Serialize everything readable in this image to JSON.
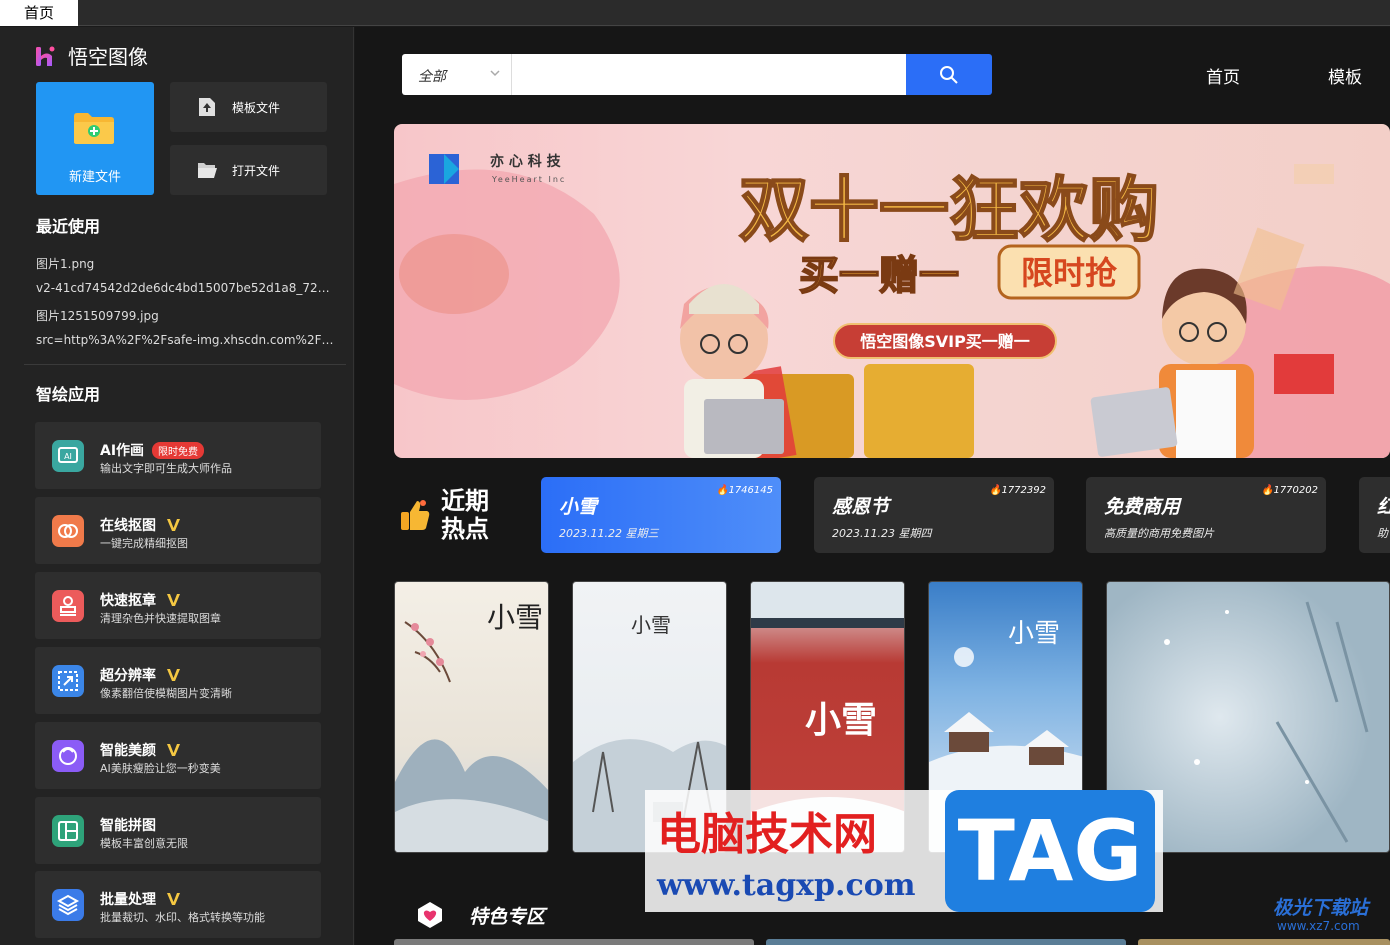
{
  "window": {
    "tab_label": "首页"
  },
  "brand": {
    "name": "悟空图像"
  },
  "actions": {
    "new_file": "新建文件",
    "template_file": "模板文件",
    "open_file": "打开文件"
  },
  "recent": {
    "title": "最近使用",
    "items": [
      "图片1.png",
      "v2-41cd74542d2de6dc4bd15007be52d1a8_720w...",
      "图片1251509799.jpg",
      "src=http%3A%2F%2Fsafe-img.xhscdn.com%2Fb..."
    ]
  },
  "apps": {
    "title": "智绘应用",
    "free_badge": "限时免费",
    "items": [
      {
        "name": "AI作画",
        "desc": "输出文字即可生成大师作品",
        "color": "#3aa7a0"
      },
      {
        "name": "在线抠图",
        "desc": "一键完成精细抠图",
        "color": "#f07a4a"
      },
      {
        "name": "快速抠章",
        "desc": "清理杂色并快速提取图章",
        "color": "#ec5b5b"
      },
      {
        "name": "超分辨率",
        "desc": "像素翻倍使模糊图片变清晰",
        "color": "#3b86e8"
      },
      {
        "name": "智能美颜",
        "desc": "AI美肤瘦脸让您一秒变美",
        "color": "#8b5cf6"
      },
      {
        "name": "智能拼图",
        "desc": "模板丰富创意无限",
        "color": "#2ea37a"
      },
      {
        "name": "批量处理",
        "desc": "批量裁切、水印、格式转换等功能",
        "color": "#3b7be8"
      }
    ]
  },
  "search": {
    "scope": "全部",
    "placeholder": ""
  },
  "nav": {
    "home": "首页",
    "template": "模板"
  },
  "banner": {
    "company_cn": "亦 心 科 技",
    "company_en": "YeeHeart Inc",
    "headline": "双十一狂欢购",
    "sub_left": "买一赠一",
    "sub_right": "限时抢",
    "promo": "悟空图像SVIP买一赠一"
  },
  "hot": {
    "label": "近期热点",
    "cards": [
      {
        "title": "小雪",
        "sub": "2023.11.22 星期三",
        "count": "1746145"
      },
      {
        "title": "感恩节",
        "sub": "2023.11.23 星期四",
        "count": "1772392"
      },
      {
        "title": "免费商用",
        "sub": "高质量的商用免费图片",
        "count": "1770202"
      },
      {
        "title": "红",
        "sub": "助",
        "count": ""
      }
    ]
  },
  "posters": {
    "p1": "小雪",
    "p2": "小雪",
    "p3": "小雪",
    "p4": "小雪"
  },
  "feature": {
    "label": "特色专区"
  },
  "watermark": {
    "site_cn": "电脑技术网",
    "site_url": "www.tagxp.com",
    "tag": "TAG",
    "corner": "极光下载站",
    "corner_url": "www.xz7.com"
  }
}
